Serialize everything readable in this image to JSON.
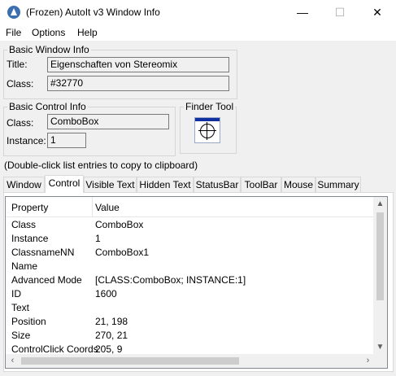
{
  "window": {
    "title": "(Frozen) AutoIt v3 Window Info",
    "minimize_glyph": "—",
    "maximize_glyph": "☐",
    "close_glyph": "✕"
  },
  "menu": [
    "File",
    "Options",
    "Help"
  ],
  "basic_window_info": {
    "legend": "Basic Window Info",
    "title_label": "Title:",
    "title_value": "Eigenschaften von Stereomix",
    "class_label": "Class:",
    "class_value": "#32770"
  },
  "basic_control_info": {
    "legend": "Basic Control Info",
    "class_label": "Class:",
    "class_value": "ComboBox",
    "instance_label": "Instance:",
    "instance_value": "1"
  },
  "finder_tool": {
    "legend": "Finder Tool",
    "icon": "crosshair-icon"
  },
  "hint": "(Double-click list entries to copy to clipboard)",
  "tabs": [
    "Window",
    "Control",
    "Visible Text",
    "Hidden Text",
    "StatusBar",
    "ToolBar",
    "Mouse",
    "Summary"
  ],
  "active_tab": "Control",
  "list": {
    "headers": [
      "Property",
      "Value"
    ],
    "rows": [
      {
        "property": "Class",
        "value": "ComboBox"
      },
      {
        "property": "Instance",
        "value": "1"
      },
      {
        "property": "ClassnameNN",
        "value": "ComboBox1"
      },
      {
        "property": "Name",
        "value": ""
      },
      {
        "property": "Advanced Mode",
        "value": "[CLASS:ComboBox; INSTANCE:1]"
      },
      {
        "property": "ID",
        "value": "1600"
      },
      {
        "property": "Text",
        "value": ""
      },
      {
        "property": "Position",
        "value": "21, 198"
      },
      {
        "property": "Size",
        "value": "270, 21"
      },
      {
        "property": "ControlClick Coords",
        "value": "205, 9"
      }
    ]
  },
  "scroll_icons": {
    "up": "▲",
    "down": "▼",
    "left": "‹",
    "right": "›"
  }
}
